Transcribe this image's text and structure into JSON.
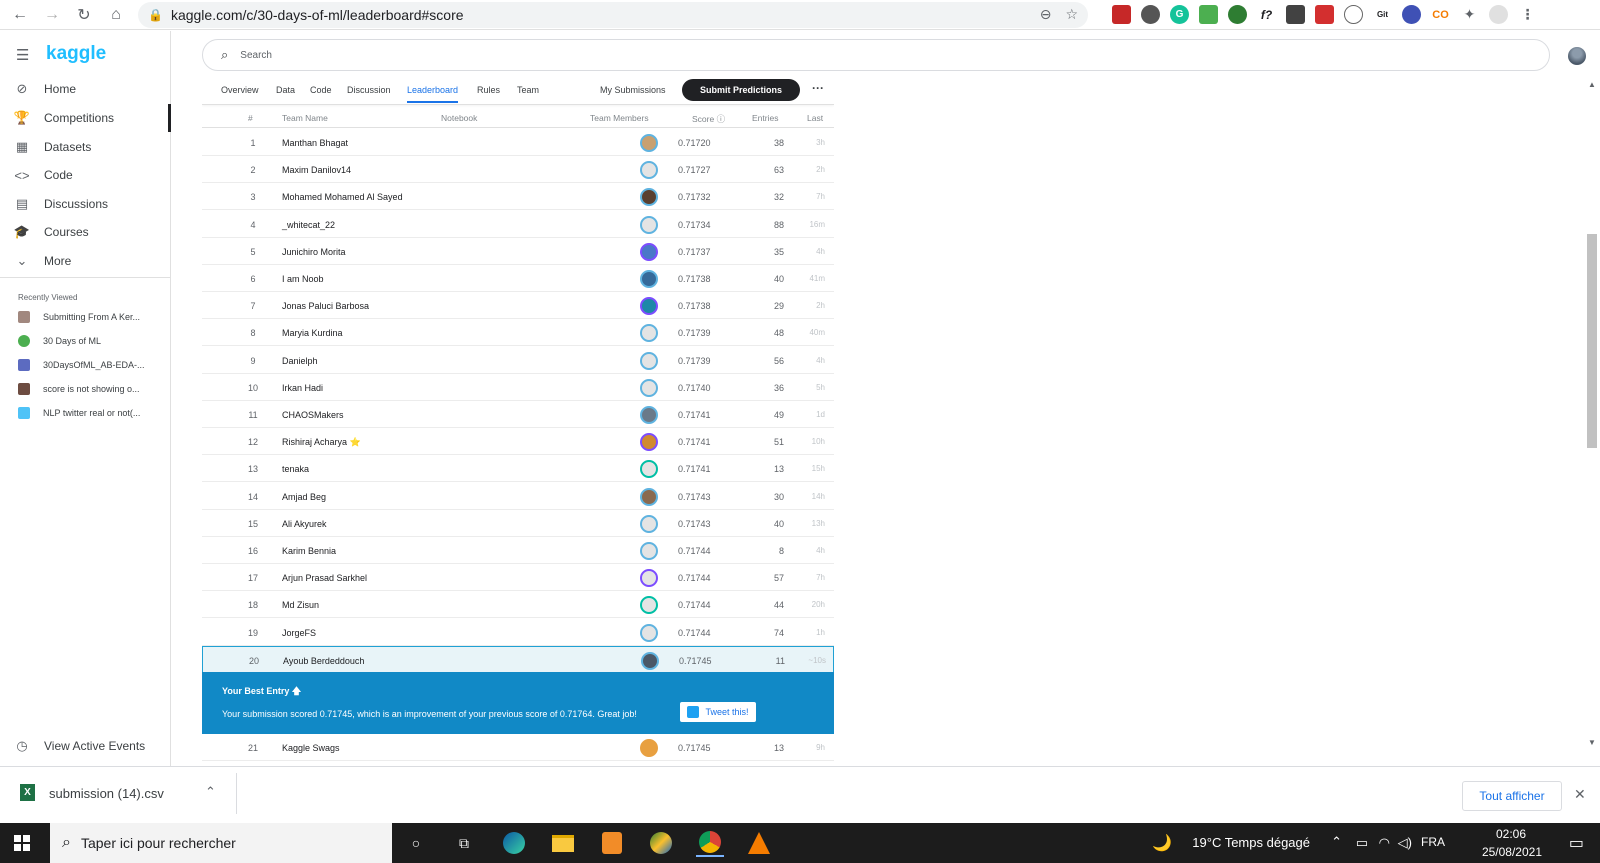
{
  "browser": {
    "url": "kaggle.com/c/30-days-of-ml/leaderboard#score"
  },
  "sidebar": {
    "logo": "kaggle",
    "items": [
      {
        "label": "Home",
        "icon": "compass-icon"
      },
      {
        "label": "Competitions",
        "icon": "trophy-icon"
      },
      {
        "label": "Datasets",
        "icon": "table-icon"
      },
      {
        "label": "Code",
        "icon": "code-icon"
      },
      {
        "label": "Discussions",
        "icon": "comments-icon"
      },
      {
        "label": "Courses",
        "icon": "school-icon"
      },
      {
        "label": "More",
        "icon": "chevron-down-icon"
      }
    ],
    "recent_title": "Recently Viewed",
    "recent": [
      "Submitting From A Ker...",
      "30 Days of ML",
      "30DaysOfML_AB-EDA-...",
      "score is not showing o...",
      "NLP twitter real or not(..."
    ],
    "events": "View Active Events"
  },
  "search": {
    "placeholder": "Search"
  },
  "tabs": [
    "Overview",
    "Data",
    "Code",
    "Discussion",
    "Leaderboard",
    "Rules",
    "Team"
  ],
  "my_submissions": "My Submissions",
  "submit": "Submit Predictions",
  "more": "···",
  "headers": {
    "rank": "#",
    "team": "Team Name",
    "notebook": "Notebook",
    "members": "Team Members",
    "score": "Score ⓘ",
    "entries": "Entries",
    "last": "Last"
  },
  "rows": [
    {
      "rank": "1",
      "name": "Manthan Bhagat",
      "score": "0.71720",
      "entries": "38",
      "last": "3h"
    },
    {
      "rank": "2",
      "name": "Maxim Danilov14",
      "score": "0.71727",
      "entries": "63",
      "last": "2h"
    },
    {
      "rank": "3",
      "name": "Mohamed Mohamed Al Sayed",
      "score": "0.71732",
      "entries": "32",
      "last": "7h"
    },
    {
      "rank": "4",
      "name": "_whitecat_22",
      "score": "0.71734",
      "entries": "88",
      "last": "16m"
    },
    {
      "rank": "5",
      "name": "Junichiro Morita",
      "score": "0.71737",
      "entries": "35",
      "last": "4h"
    },
    {
      "rank": "6",
      "name": "I am Noob",
      "score": "0.71738",
      "entries": "40",
      "last": "41m"
    },
    {
      "rank": "7",
      "name": "Jonas Paluci Barbosa",
      "score": "0.71738",
      "entries": "29",
      "last": "2h"
    },
    {
      "rank": "8",
      "name": "Maryia Kurdina",
      "score": "0.71739",
      "entries": "48",
      "last": "40m"
    },
    {
      "rank": "9",
      "name": "Danielph",
      "score": "0.71739",
      "entries": "56",
      "last": "4h"
    },
    {
      "rank": "10",
      "name": "Irkan Hadi",
      "score": "0.71740",
      "entries": "36",
      "last": "5h"
    },
    {
      "rank": "11",
      "name": "CHAOSMakers",
      "score": "0.71741",
      "entries": "49",
      "last": "1d"
    },
    {
      "rank": "12",
      "name": "Rishiraj Acharya ⭐",
      "score": "0.71741",
      "entries": "51",
      "last": "10h"
    },
    {
      "rank": "13",
      "name": "tenaka",
      "score": "0.71741",
      "entries": "13",
      "last": "15h"
    },
    {
      "rank": "14",
      "name": "Amjad Beg",
      "score": "0.71743",
      "entries": "30",
      "last": "14h"
    },
    {
      "rank": "15",
      "name": "Ali Akyurek",
      "score": "0.71743",
      "entries": "40",
      "last": "13h"
    },
    {
      "rank": "16",
      "name": "Karim Bennia",
      "score": "0.71744",
      "entries": "8",
      "last": "4h"
    },
    {
      "rank": "17",
      "name": "Arjun Prasad Sarkhel",
      "score": "0.71744",
      "entries": "57",
      "last": "7h"
    },
    {
      "rank": "18",
      "name": "Md Zisun",
      "score": "0.71744",
      "entries": "44",
      "last": "20h"
    },
    {
      "rank": "19",
      "name": "JorgeFS",
      "score": "0.71744",
      "entries": "74",
      "last": "1h"
    },
    {
      "rank": "20",
      "name": "Ayoub Berdeddouch",
      "score": "0.71745",
      "entries": "11",
      "last": "~10s"
    }
  ],
  "best": {
    "title": "Your Best Entry 🡅",
    "message": "Your submission scored 0.71745, which is an improvement of your previous score of 0.71764. Great job!",
    "tweet": "Tweet this!"
  },
  "row21": {
    "rank": "21",
    "name": "Kaggle Swags",
    "score": "0.71745",
    "entries": "13",
    "last": "9h"
  },
  "download": {
    "file": "submission (14).csv",
    "show_all": "Tout afficher"
  },
  "taskbar": {
    "search": "Taper ici pour rechercher",
    "weather": "19°C  Temps dégagé",
    "lang": "FRA",
    "time": "02:06",
    "date": "25/08/2021"
  },
  "colors": {
    "accent": "#20beff",
    "best_banner": "#1189c6",
    "highlight": "#e8f4f8"
  }
}
